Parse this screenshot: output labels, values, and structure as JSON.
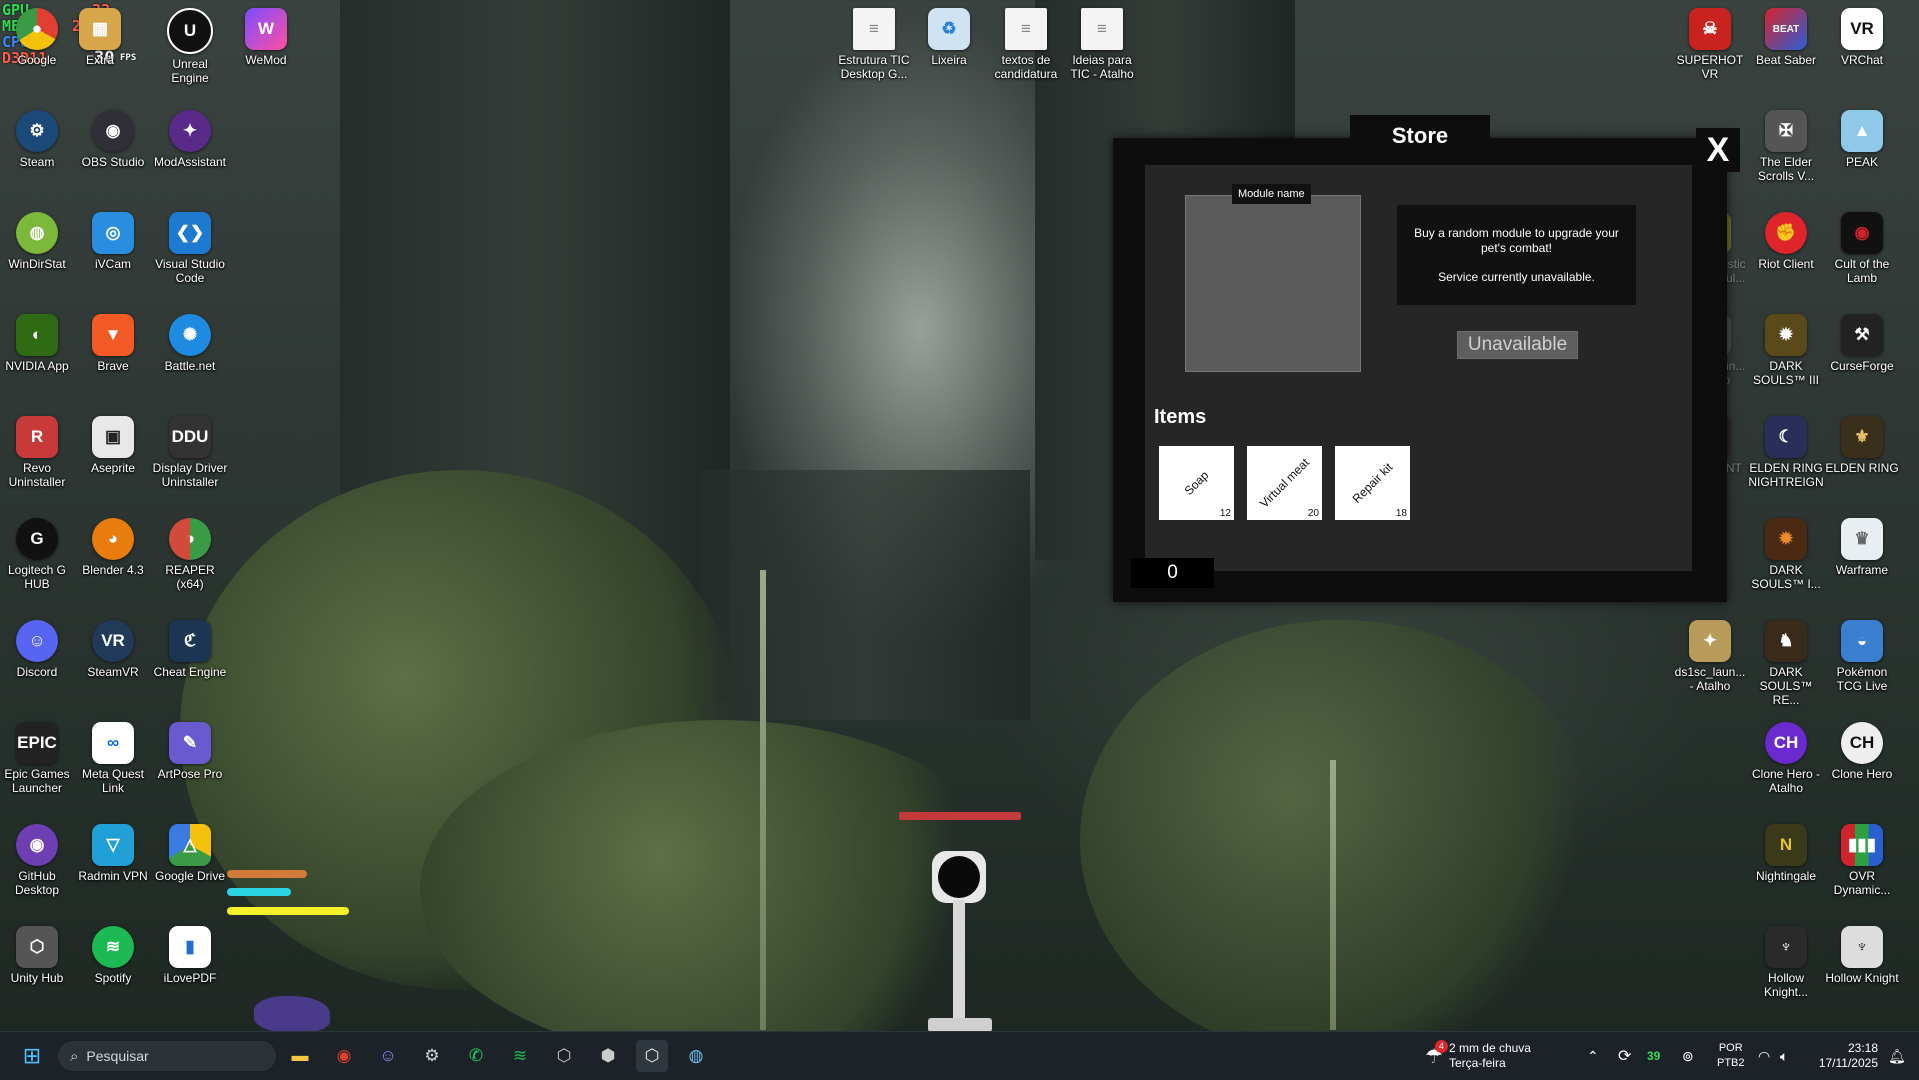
{
  "hud": {
    "gpu_label": "GPU",
    "gpu_val": "33",
    "mem_label": "MEM",
    "mem_val": "2060",
    "cpu_label": "CPU",
    "cpu_val": "39",
    "api": "D3D11",
    "fps_val": "30",
    "fps_label": "FPS"
  },
  "desktop_icons": {
    "google": "Google",
    "extra": "Extra",
    "unreal": "Unreal Engine",
    "wemod": "WeMod",
    "estrutura": "Estrutura TIC Desktop G...",
    "lixeira": "Lixeira",
    "textos": "textos de candidatura",
    "ideias": "Ideias para TIC - Atalho",
    "superhot": "SUPERHOT VR",
    "beatsaber": "Beat Saber",
    "vrchat": "VRChat",
    "steam": "Steam",
    "obs": "OBS Studio",
    "modassistant": "ModAssistant",
    "elderscrolls": "The Elder Scrolls V...",
    "peak": "PEAK",
    "windirstat": "WinDirStat",
    "ivcam": "iVCam",
    "vscode": "Visual Studio Code",
    "placid": "Placid Plastic Duck Simul...",
    "riot": "Riot Client",
    "cult": "Cult of the Lamb",
    "nvidia": "NVIDIA App",
    "brave": "Brave",
    "battlenet": "Battle.net",
    "ds1launcher": "ds1sc_laun... - Atalho",
    "darksouls3": "DARK SOULS™ III",
    "curseforge": "CurseForge",
    "revo": "Revo Uninstaller",
    "aseprite": "Aseprite",
    "ddu": "Display Driver Uninstaller",
    "valorant": "VALORANT",
    "nightreign": "ELDEN RING NIGHTREIGN",
    "eldenring": "ELDEN RING",
    "logitech": "Logitech G HUB",
    "blender": "Blender 4.3",
    "reaper": "REAPER (x64)",
    "darksouls2": "DARK SOULS™ I...",
    "warframe": "Warframe",
    "discord": "Discord",
    "steamvr": "SteamVR",
    "cheatengine": "Cheat Engine",
    "ds1sc": "ds1sc_laun... - Atalho",
    "darksoulsre": "DARK SOULS™ RE...",
    "pokemon": "Pokémon TCG Live",
    "epic": "Epic Games Launcher",
    "metaquest": "Meta Quest Link",
    "artpose": "ArtPose Pro",
    "clonehero_atalho": "Clone Hero - Atalho",
    "clonehero": "Clone Hero",
    "github": "GitHub Desktop",
    "radmin": "Radmin VPN",
    "gdrive": "Google Drive",
    "nightingale": "Nightingale",
    "ovr": "OVR Dynamic...",
    "unityhub": "Unity Hub",
    "spotify": "Spotify",
    "ilovepdf": "iLovePDF",
    "hollowknight2": "Hollow Knight...",
    "hollowknight": "Hollow Knight"
  },
  "store": {
    "title": "Store",
    "close": "X",
    "module_name": "Module name",
    "desc_line1": "Buy a random module to upgrade your pet's combat!",
    "desc_line2": "Service currently unavailable.",
    "button": "Unavailable",
    "items_label": "Items",
    "items": [
      {
        "name": "Soap",
        "count": "12"
      },
      {
        "name": "Virtual meat",
        "count": "20"
      },
      {
        "name": "Repair kit",
        "count": "18"
      }
    ],
    "counter": "0"
  },
  "taskbar": {
    "search_placeholder": "Pesquisar",
    "weather_badge": "4",
    "weather_text": "2 mm de chuva",
    "weather_day": "Terça-feira",
    "tray_count": "39",
    "lang1": "POR",
    "lang2": "PTB2",
    "time": "23:18",
    "date": "17/11/2025"
  }
}
